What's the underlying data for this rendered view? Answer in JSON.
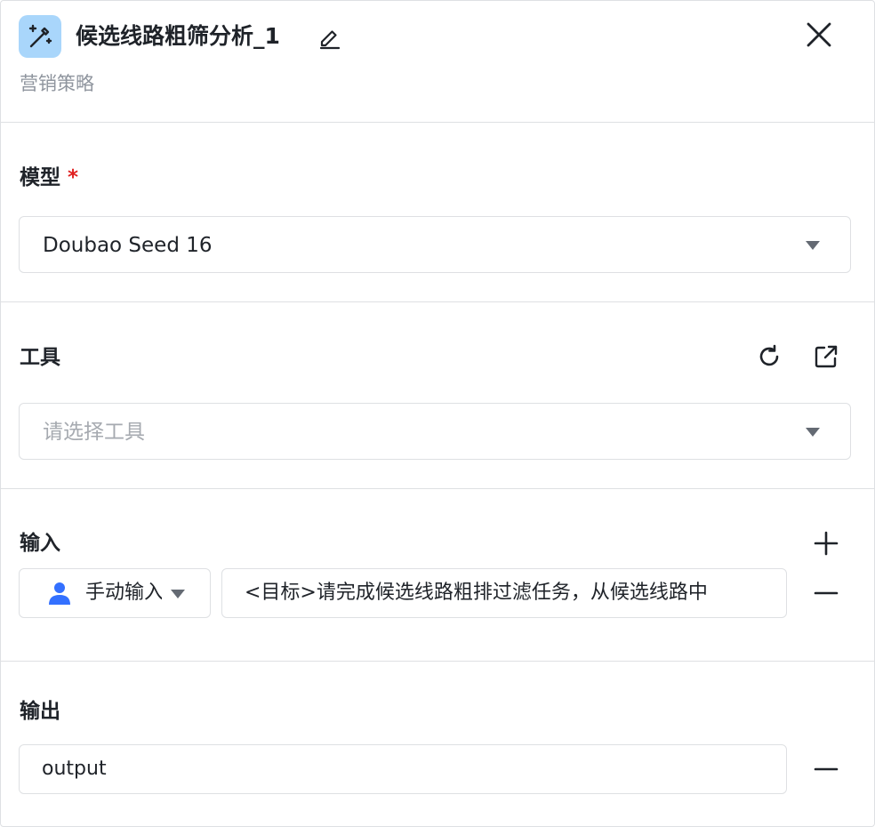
{
  "header": {
    "title": "候选线路粗筛分析_1",
    "subtitle": "营销策略",
    "app_icon": "magic-wand-icon",
    "edit_icon": "edit-icon",
    "close_icon": "close-icon"
  },
  "model": {
    "label": "模型",
    "required_mark": "*",
    "value": "Doubao Seed 16"
  },
  "tools": {
    "label": "工具",
    "placeholder": "请选择工具",
    "refresh_icon": "refresh-icon",
    "external_link_icon": "external-link-icon"
  },
  "input": {
    "label": "输入",
    "mode_value": "手动输入",
    "text_value": "<目标>请完成候选线路粗排过滤任务，从候选线路中",
    "add_icon": "plus-icon",
    "remove_icon": "minus-icon"
  },
  "output": {
    "label": "输出",
    "value": "output",
    "remove_icon": "minus-icon"
  },
  "colors": {
    "accent": "#3370ff",
    "icon_bg": "#a9d6fb",
    "border": "#dee0e3",
    "required": "#e02020",
    "placeholder": "#a6aab0",
    "subtitle": "#8f959e"
  }
}
